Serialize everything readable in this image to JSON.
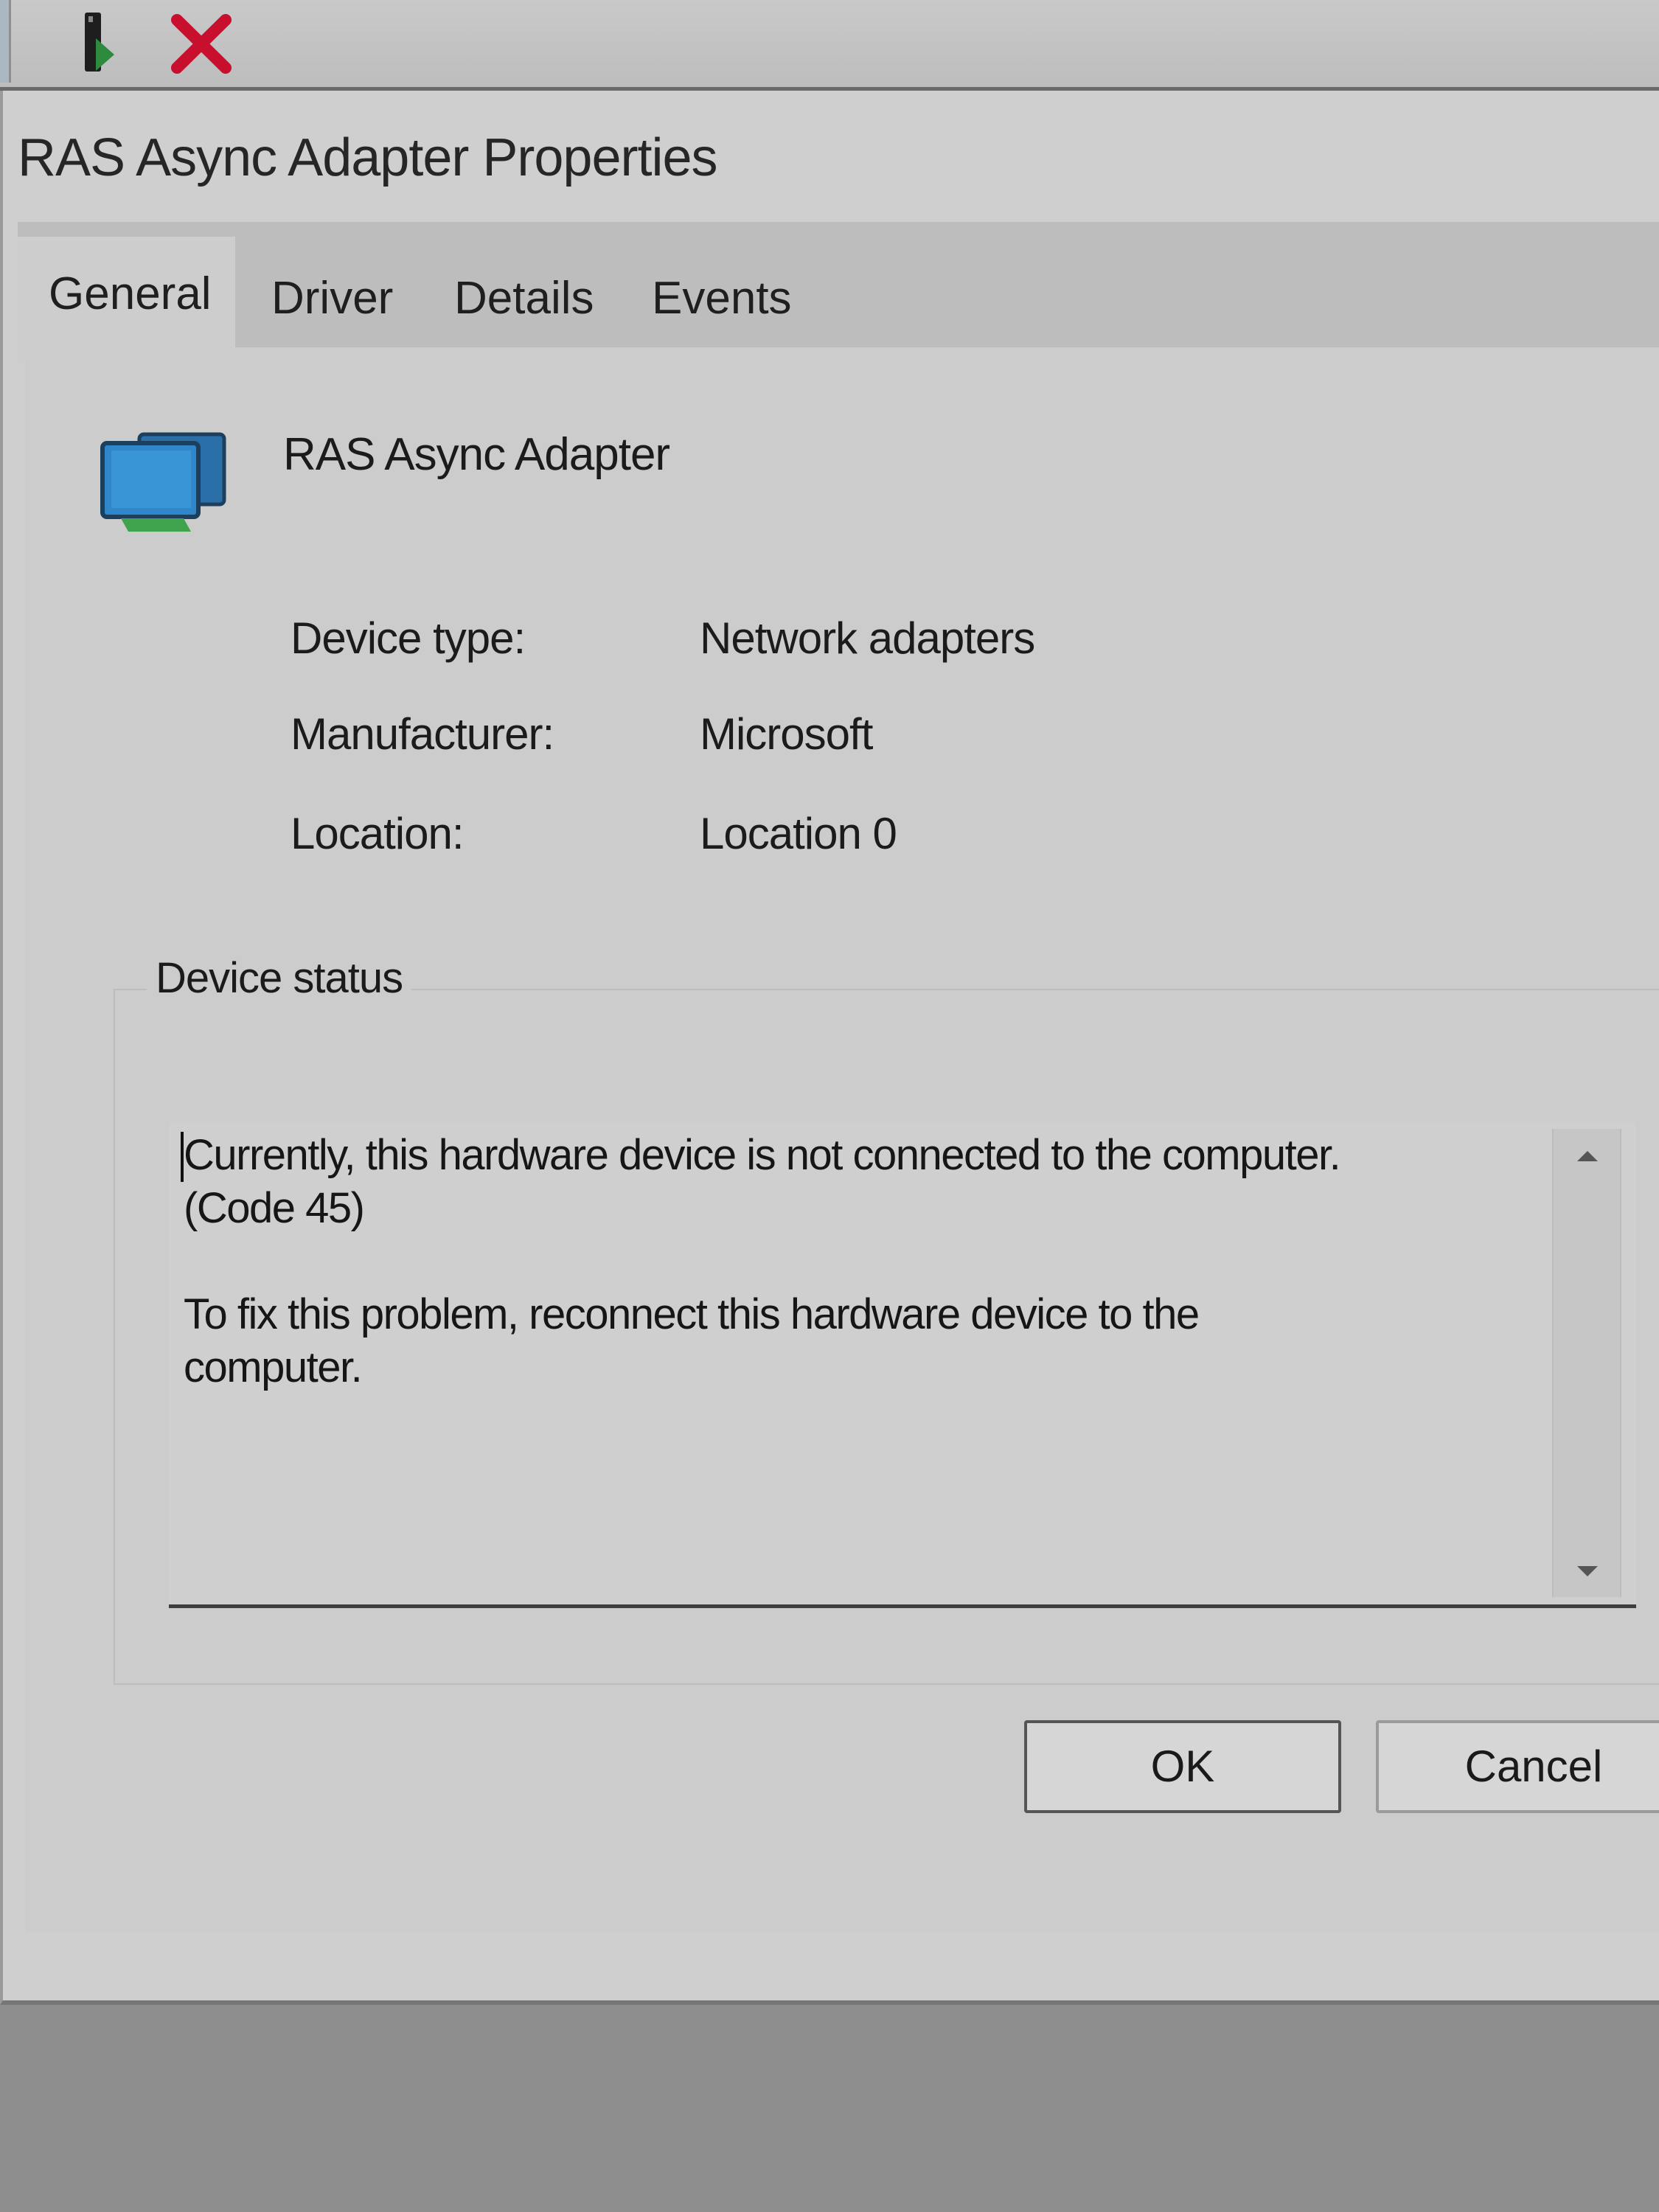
{
  "toolbar": {
    "icons": [
      {
        "name": "enable-device-icon",
        "color": "#2e8b3e"
      },
      {
        "name": "uninstall-device-icon",
        "color": "#c8102e"
      }
    ]
  },
  "dialog": {
    "title": "RAS Async Adapter Properties",
    "tabs": [
      {
        "label": "General",
        "active": true
      },
      {
        "label": "Driver",
        "active": false
      },
      {
        "label": "Details",
        "active": false
      },
      {
        "label": "Events",
        "active": false
      }
    ],
    "device": {
      "icon": "network-adapter-icon",
      "name": "RAS Async Adapter",
      "properties": [
        {
          "label": "Device type:",
          "value": "Network adapters"
        },
        {
          "label": "Manufacturer:",
          "value": "Microsoft"
        },
        {
          "label": "Location:",
          "value": "Location 0"
        }
      ]
    },
    "device_status": {
      "label": "Device status",
      "text": "Currently, this hardware device is not connected to the computer.\n(Code 45)\n\nTo fix this problem, reconnect this hardware device to the\ncomputer."
    },
    "buttons": {
      "ok": "OK",
      "cancel": "Cancel"
    }
  }
}
